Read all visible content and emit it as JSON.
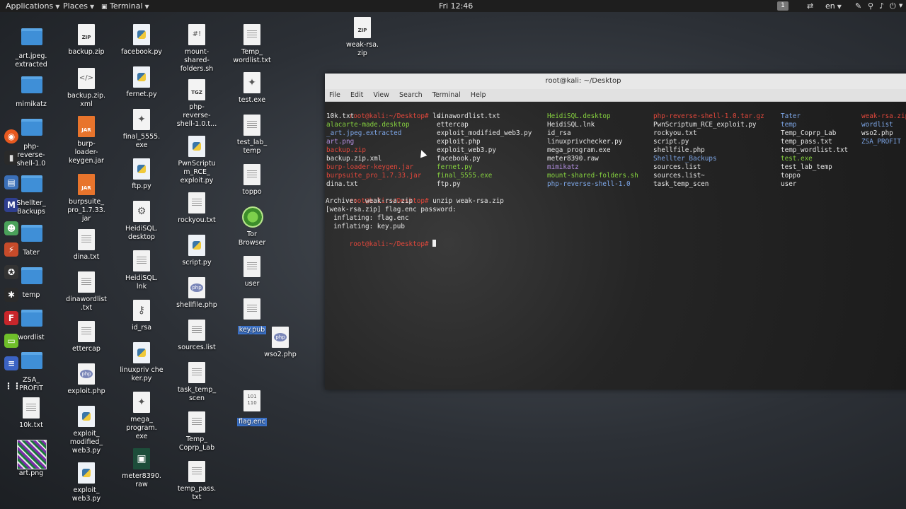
{
  "topbar": {
    "applications": "Applications",
    "places": "Places",
    "terminal": "Terminal",
    "clock": "Fri 12:46",
    "workspace": "1",
    "language": "en"
  },
  "terminal": {
    "title": "root@kali: ~/Desktop",
    "menus": [
      "File",
      "Edit",
      "View",
      "Search",
      "Terminal",
      "Help"
    ],
    "prompt": "root@kali:~/Desktop#",
    "cmd1": " ls",
    "ls": [
      [
        "10k.txt",
        "dinawordlist.txt",
        "HeidiSQL.desktop",
        "php-reverse-shell-1.0.tar.gz",
        "Tater",
        "weak-rsa.zip"
      ],
      [
        "alacarte-made.desktop",
        "ettercap",
        "HeidiSQL.lnk",
        "PwnScriptum_RCE_exploit.py",
        "temp",
        "wordlist"
      ],
      [
        "_art.jpeg.extracted",
        "exploit_modified_web3.py",
        "id_rsa",
        "rockyou.txt",
        "Temp_Coprp_Lab",
        "wso2.php"
      ],
      [
        "art.png",
        "exploit.php",
        "linuxprivchecker.py",
        "script.py",
        "temp_pass.txt",
        "ZSA_PROFIT"
      ],
      [
        "backup.zip",
        "exploit_web3.py",
        "mega_program.exe",
        "shellfile.php",
        "temp_wordlist.txt",
        ""
      ],
      [
        "backup.zip.xml",
        "facebook.py",
        "meter8390.raw",
        "Shellter_Backups",
        "test.exe",
        ""
      ],
      [
        "burp-loader-keygen.jar",
        "fernet.py",
        "mimikatz",
        "sources.list",
        "test_lab_temp",
        ""
      ],
      [
        "burpsuite_pro_1.7.33.jar",
        "final_5555.exe",
        "mount-shared-folders.sh",
        "sources.list~",
        "toppo",
        ""
      ],
      [
        "dina.txt",
        "ftp.py",
        "php-reverse-shell-1.0",
        "task_temp_scen",
        "user",
        ""
      ]
    ],
    "cmd2": " unzip weak-rsa.zip",
    "out1": "Archive:  weak-rsa.zip",
    "out2": "[weak-rsa.zip] flag.enc password: ",
    "out3": "  inflating: flag.enc",
    "out4": "  inflating: key.pub"
  },
  "desktop": {
    "c1": [
      "_art.jpeg.\nextracted",
      "mimikatz",
      "php-\nreverse-\nshell-1.0",
      "Shellter_\nBackups",
      "Tater",
      "temp",
      "wordlist",
      "ZSA_\nPROFIT",
      "10k.txt",
      "art.png"
    ],
    "c2": [
      "backup.zip",
      "backup.zip.\nxml",
      "burp-\nloader-\nkeygen.jar",
      "burpsuite_\npro_1.7.33.\njar",
      "dina.txt",
      "dinawordlist\n.txt",
      "ettercap",
      "exploit.php",
      "exploit_\nmodified_\nweb3.py",
      "exploit_\nweb3.py"
    ],
    "c3": [
      "facebook.py",
      "fernet.py",
      "final_5555.\nexe",
      "ftp.py",
      "HeidiSQL.\ndesktop",
      "HeidiSQL.\nlnk",
      "id_rsa",
      "linuxpriv che\nker.py",
      "mega_\nprogram.\nexe",
      "meter8390.\nraw"
    ],
    "c4": [
      "mount-\nshared-\nfolders.sh",
      "php-\nreverse-\nshell-1.0.t...",
      "PwnScriptu\nm_RCE_\nexploit.py",
      "rockyou.txt",
      "script.py",
      "shellfile.php",
      "sources.list",
      "task_temp_\nscen",
      "Temp_\nCoprp_Lab",
      "temp_pass.\ntxt"
    ],
    "c5": [
      "Temp_\nwordlist.txt",
      "test.exe",
      "test_lab_\ntemp",
      "toppo",
      "Tor\nBrowser",
      "user",
      "key.pub",
      "flag.enc"
    ],
    "weak": "weak-rsa.\nzip",
    "wso2": "wso2.php"
  },
  "colors": {
    "folder": "#3f8fd7",
    "selection": "#3b71c7",
    "terminal_red": "#e0473b",
    "terminal_green": "#86d23f",
    "terminal_blue": "#7ea7e8"
  }
}
